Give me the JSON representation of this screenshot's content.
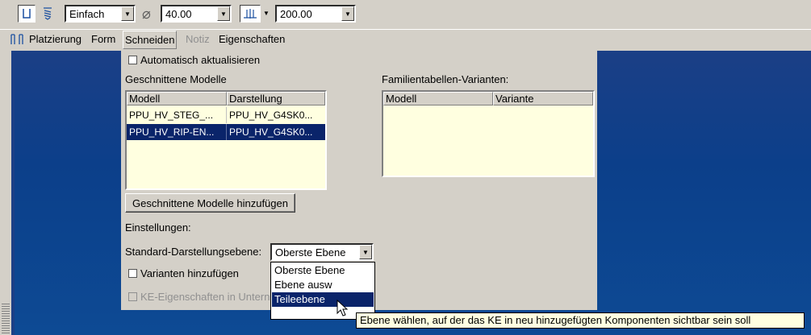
{
  "toolbar": {
    "mode_combo": "Einfach",
    "diameter_symbol": "⌀",
    "diameter_value": "40.00",
    "depth_value": "200.00"
  },
  "tabs": [
    {
      "label": "Platzierung"
    },
    {
      "label": "Form"
    },
    {
      "label": "Schneiden"
    },
    {
      "label": "Notiz"
    },
    {
      "label": "Eigenschaften"
    }
  ],
  "panel": {
    "auto_update_label": "Automatisch aktualisieren",
    "cut_models_title": "Geschnittene Modelle",
    "cut_models_headers": [
      "Modell",
      "Darstellung"
    ],
    "cut_models_rows": [
      [
        "PPU_HV_STEG_...",
        "PPU_HV_G4SK0..."
      ],
      [
        "PPU_HV_RIP-EN...",
        "PPU_HV_G4SK0..."
      ]
    ],
    "family_title": "Familientabellen-Varianten:",
    "family_headers": [
      "Modell",
      "Variante"
    ],
    "add_models_button": "Geschnittene Modelle hinzufügen",
    "settings_label": "Einstellungen:",
    "std_level_label": "Standard-Darstellungsebene:",
    "std_level_value": "Oberste Ebene",
    "add_variants_label": "Varianten hinzufügen",
    "ke_props_label": "KE-Eigenschaften in Untern"
  },
  "dropdown": {
    "options": [
      "Oberste Ebene",
      "Ebene ausw",
      "Teileebene"
    ],
    "selected_index": 2
  },
  "tooltip": "Ebene wählen, auf der das KE in neu hinzugefügten Komponenten sichtbar sein soll",
  "colors": {
    "selection": "#0a246a",
    "table_bg": "#ffffe0",
    "background_blue": "#0c3f8a"
  }
}
